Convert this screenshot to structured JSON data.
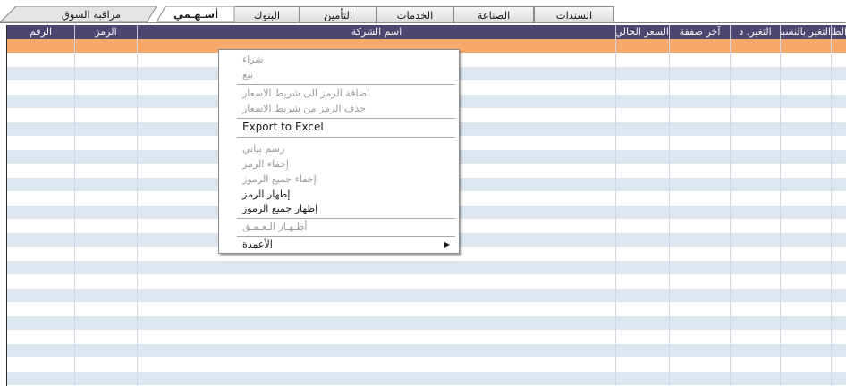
{
  "tabs": [
    {
      "label": "السندات"
    },
    {
      "label": "الصناعة"
    },
    {
      "label": "الخدمات"
    },
    {
      "label": "التأمين"
    },
    {
      "label": "البنوك"
    },
    {
      "label": "أسـهـمي"
    },
    {
      "label": "مراقبة السوق"
    }
  ],
  "grid": {
    "columns": [
      {
        "label": "الرقم"
      },
      {
        "label": "الرمز"
      },
      {
        "label": "اسم الشركة"
      },
      {
        "label": "السعر الحالي"
      },
      {
        "label": "آخر صفقة"
      },
      {
        "label": "التغير. د"
      },
      {
        "label": "التغير بالنسبة"
      },
      {
        "label": "الطلب"
      }
    ],
    "row_count": 25,
    "selected_row": 1
  },
  "context_menu": {
    "items": [
      {
        "label": "شراء",
        "enabled": false
      },
      {
        "label": "بيع",
        "enabled": false
      },
      {
        "label": "اضافة الرمز الى شريط الاسعار",
        "enabled": false
      },
      {
        "label": "حذف الرمز من شريط الاسعار",
        "enabled": false
      },
      {
        "label": "Export to Excel",
        "enabled": true
      },
      {
        "label": "رسم بياني",
        "enabled": false
      },
      {
        "label": "إخفاء الرمز",
        "enabled": false
      },
      {
        "label": "إخفاء جميع الرموز",
        "enabled": false
      },
      {
        "label": "إظهار الرمز",
        "enabled": true
      },
      {
        "label": "إظهار جميع الرموز",
        "enabled": true
      },
      {
        "label": "أظـهـار الـعـمـق",
        "enabled": false
      },
      {
        "label": "الأعمدة",
        "enabled": true,
        "submenu_icon": "arrow-right-icon"
      }
    ]
  },
  "colors": {
    "header_bg": "#4c4771",
    "selected_row": "#f7a86b",
    "row_alt": "#dde6f0"
  }
}
